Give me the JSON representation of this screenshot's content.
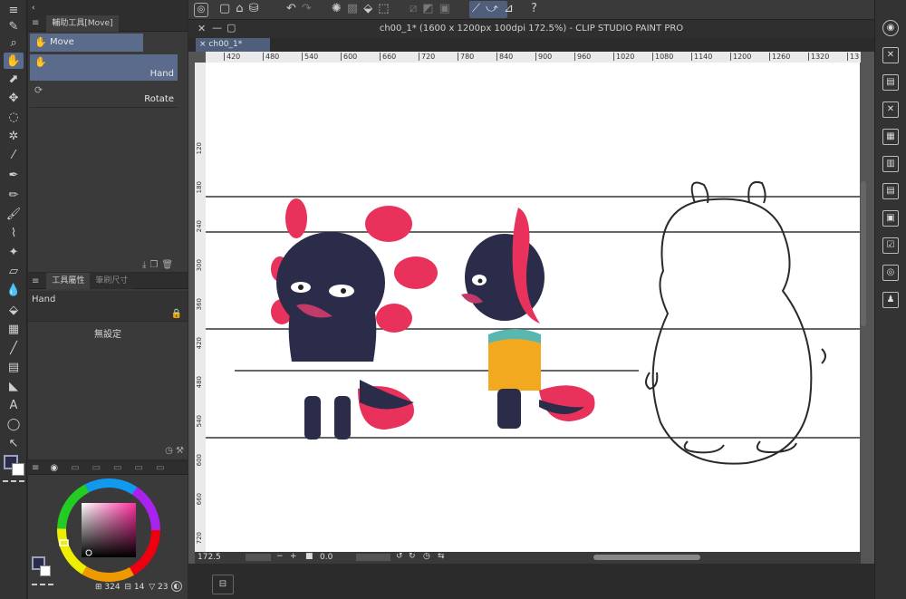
{
  "window": {
    "title": "ch00_1* (1600 x 1200px 100dpi 172.5%)  - CLIP STUDIO PAINT PRO"
  },
  "subtool": {
    "header": "輔助工具[Move]",
    "items": [
      {
        "label": "Move"
      },
      {
        "label": "Hand"
      },
      {
        "label": "Rotate"
      }
    ]
  },
  "tool_property": {
    "tab_active": "工具屬性",
    "tab_inactive": "筆刷尺寸",
    "tool_name": "Hand",
    "empty_text": "無設定"
  },
  "document": {
    "tab_label": "ch00_1*"
  },
  "ruler": {
    "h_ticks": [
      "420",
      "480",
      "540",
      "600",
      "660",
      "720",
      "780",
      "840",
      "900",
      "960",
      "1020",
      "1080",
      "1140",
      "1200",
      "1260",
      "1320",
      "13"
    ],
    "v_ticks": [
      "120",
      "180",
      "240",
      "300",
      "360",
      "420",
      "480",
      "540",
      "600",
      "660",
      "720"
    ]
  },
  "status": {
    "zoom": "172.5",
    "rotation": "0.0"
  },
  "color": {
    "r": "324",
    "g": "14",
    "b": "23"
  },
  "colors": {
    "accent": "#5b6b8c",
    "main_color": "#2b2b4a",
    "sub_color": "#ffffff"
  }
}
